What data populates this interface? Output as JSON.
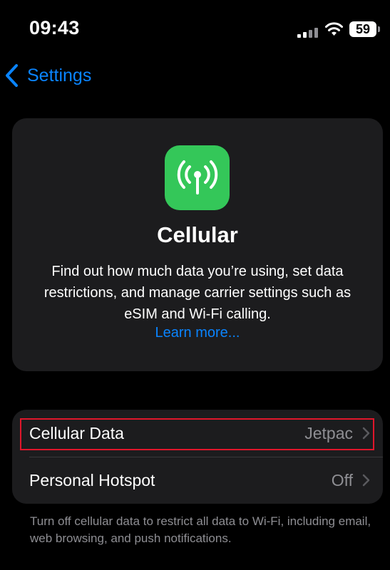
{
  "status_bar": {
    "time": "09:43",
    "battery": "59",
    "icons": [
      "signal-icon",
      "wifi-icon",
      "battery-icon"
    ]
  },
  "nav": {
    "back_label": "Settings",
    "back_icon": "chevron-left-icon"
  },
  "hero": {
    "icon": "antenna-icon",
    "title": "Cellular",
    "description": "Find out how much data you’re using, set data restrictions, and manage carrier settings such as eSIM and Wi-Fi calling.",
    "link": "Learn more..."
  },
  "list": {
    "rows": [
      {
        "label": "Cellular Data",
        "value": "Jetpac"
      },
      {
        "label": "Personal Hotspot",
        "value": "Off"
      }
    ]
  },
  "footer": {
    "note": "Turn off cellular data to restrict all data to Wi-Fi, including email, web browsing, and push notifications."
  },
  "colors": {
    "background": "#000000",
    "card": "#1c1c1e",
    "accent": "#0a84ff",
    "app_icon": "#34c759",
    "secondary_text": "#8e8e93",
    "highlight": "#e0162b"
  }
}
